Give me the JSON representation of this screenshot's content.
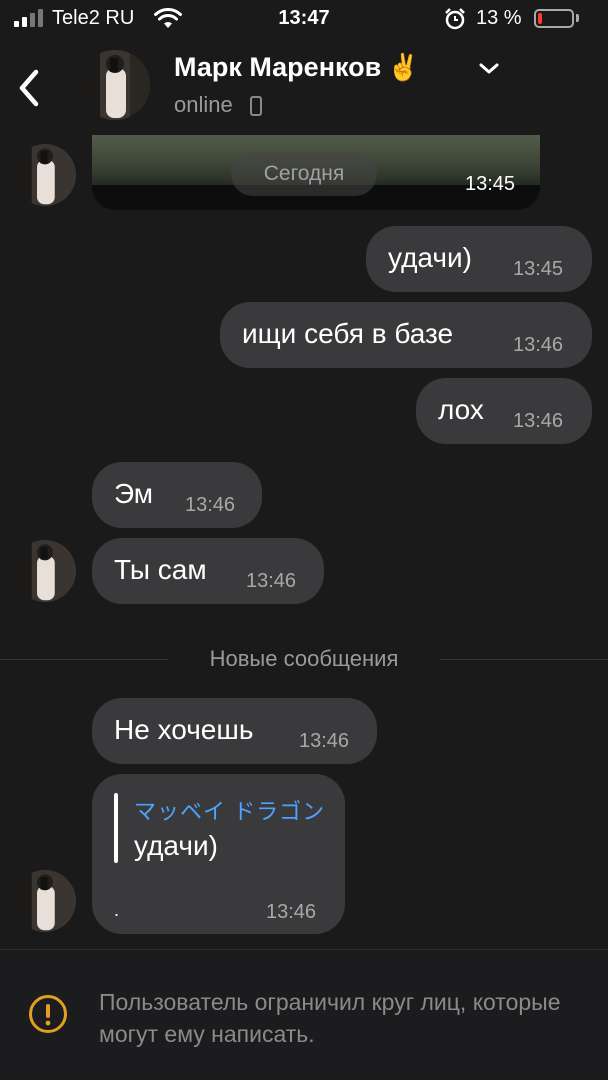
{
  "status_bar": {
    "carrier": "Tele2 RU",
    "time": "13:47",
    "battery_percent": "13 %",
    "battery_level": 0.13
  },
  "header": {
    "name": "Марк Маренков",
    "emoji": "✌️",
    "status": "online"
  },
  "image_message": {
    "date_label": "Сегодня",
    "time": "13:45"
  },
  "messages": [
    {
      "text": "удачи)",
      "time": "13:45",
      "side": "out"
    },
    {
      "text": "ищи себя в базе",
      "time": "13:46",
      "side": "out"
    },
    {
      "text": "лох",
      "time": "13:46",
      "side": "out"
    },
    {
      "text": "Эм",
      "time": "13:46",
      "side": "in"
    },
    {
      "text": "Ты сам",
      "time": "13:46",
      "side": "in"
    },
    {
      "text": "Не хочешь",
      "time": "13:46",
      "side": "in"
    }
  ],
  "new_messages_divider": "Новые сообщения",
  "reply_message": {
    "quoted_name": "マッベイ ドラゴン",
    "quoted_text": "удачи)",
    "body": ".",
    "time": "13:46"
  },
  "notice": "Пользователь ограничил круг лиц, которые могут ему написать.",
  "colors": {
    "background": "#1a1a1a",
    "bubble": "#3a3a3c",
    "accent_link": "#4da3ff",
    "warning": "#e0a020",
    "battery_low": "#ff3b30"
  }
}
